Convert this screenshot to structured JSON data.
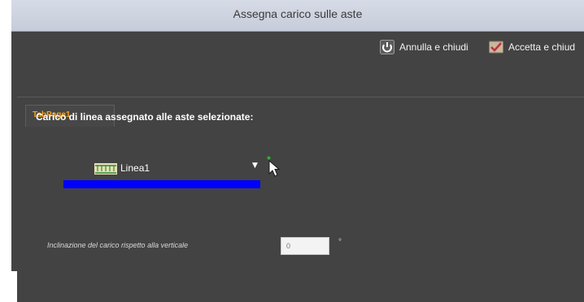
{
  "window": {
    "title": "Assegna carico sulle aste"
  },
  "toolbar": {
    "cancel_label": "Annulla e chiudi",
    "cancel_icon": "power-icon",
    "accept_label": "Accetta e chiud",
    "accept_icon": "checkmark-icon"
  },
  "tabs": [
    {
      "label": "TabPage1",
      "selected": true
    }
  ],
  "main": {
    "section_label": "Carico di linea assegnato alle aste selezionate:",
    "load_combo": {
      "selected": "Linea1",
      "icon": "distributed-load-icon"
    },
    "pick_icon": "pointer-arrow-icon",
    "inclination": {
      "label": "Inclinazione del carico rispetto alla verticale",
      "value": "0",
      "unit": "°"
    }
  },
  "colors": {
    "title_bar": "#c6ccd9",
    "panel_background": "#434343",
    "tab_label": "#f4a21e",
    "load_bar": "#0000ff"
  }
}
